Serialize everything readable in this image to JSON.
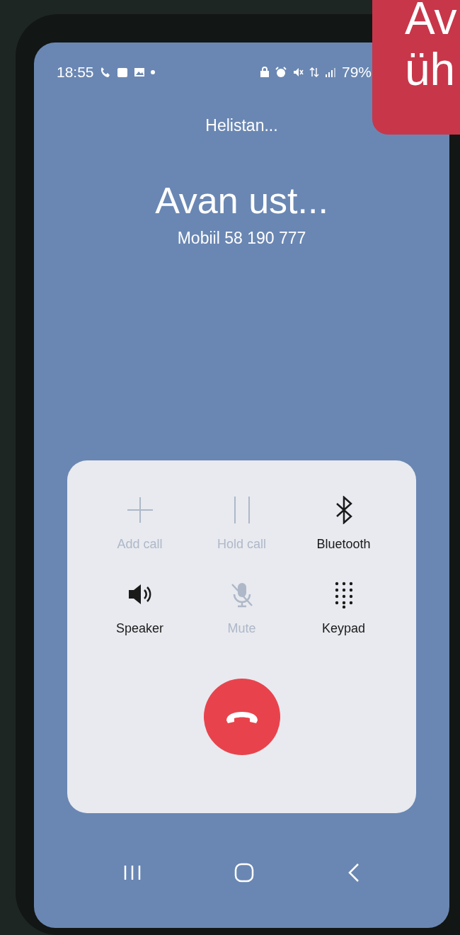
{
  "status_bar": {
    "time": "18:55",
    "battery": "79%"
  },
  "call": {
    "status": "Helistan...",
    "name": "Avan ust...",
    "number": "Mobiil 58 190 777"
  },
  "actions": [
    {
      "kind": "add",
      "label": "Add call",
      "disabled": true
    },
    {
      "kind": "hold",
      "label": "Hold call",
      "disabled": true
    },
    {
      "kind": "bluetooth",
      "label": "Bluetooth",
      "disabled": false
    },
    {
      "kind": "speaker",
      "label": "Speaker",
      "disabled": false
    },
    {
      "kind": "mute",
      "label": "Mute",
      "disabled": true
    },
    {
      "kind": "keypad",
      "label": "Keypad",
      "disabled": false
    }
  ],
  "banner": {
    "lines": [
      "Av",
      "üh"
    ]
  }
}
